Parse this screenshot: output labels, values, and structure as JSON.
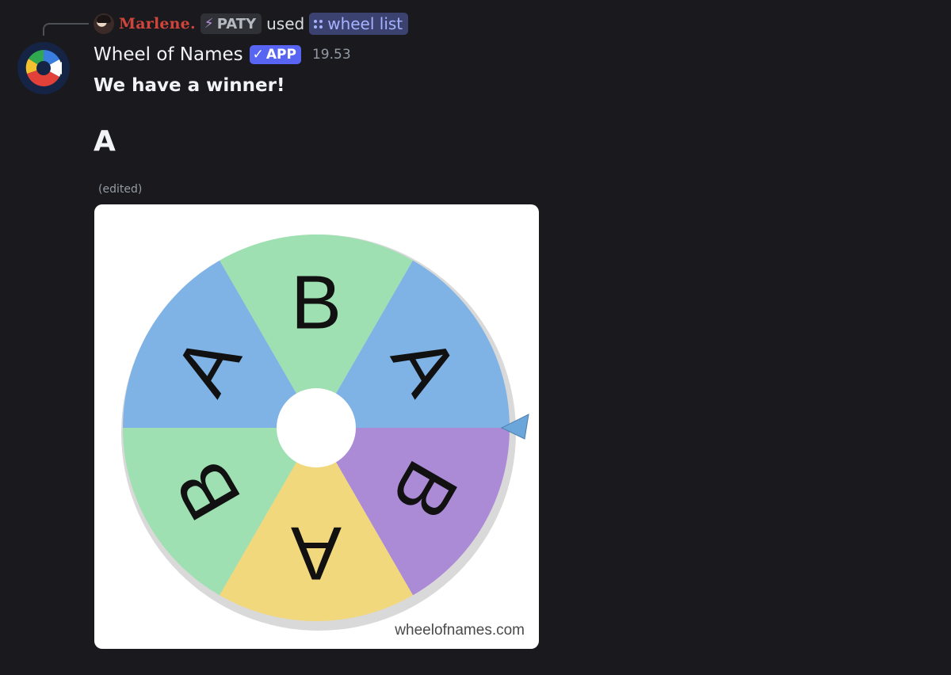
{
  "reply": {
    "username": "Marlene.",
    "tag": "PATY",
    "used_text": "used",
    "command": "wheel list"
  },
  "message": {
    "author": "Wheel of Names",
    "badge": "APP",
    "timestamp": "19.53",
    "line1": "We have a winner!",
    "winner": "A",
    "edited": "(edited)"
  },
  "wheel": {
    "segments": [
      {
        "label": "B",
        "color": "#9ee0b1"
      },
      {
        "label": "A",
        "color": "#7fb3e6"
      },
      {
        "label": "B",
        "color": "#ab8ad6"
      },
      {
        "label": "A",
        "color": "#f2d87c"
      },
      {
        "label": "B",
        "color": "#9ee0b1"
      },
      {
        "label": "A",
        "color": "#7fb3e6"
      }
    ],
    "watermark": "wheelofnames.com"
  },
  "colors": {
    "background": "#1a1a1e",
    "accent": "#5865f2",
    "reply_username": "#d0453b",
    "command": "#a6b2ff"
  }
}
